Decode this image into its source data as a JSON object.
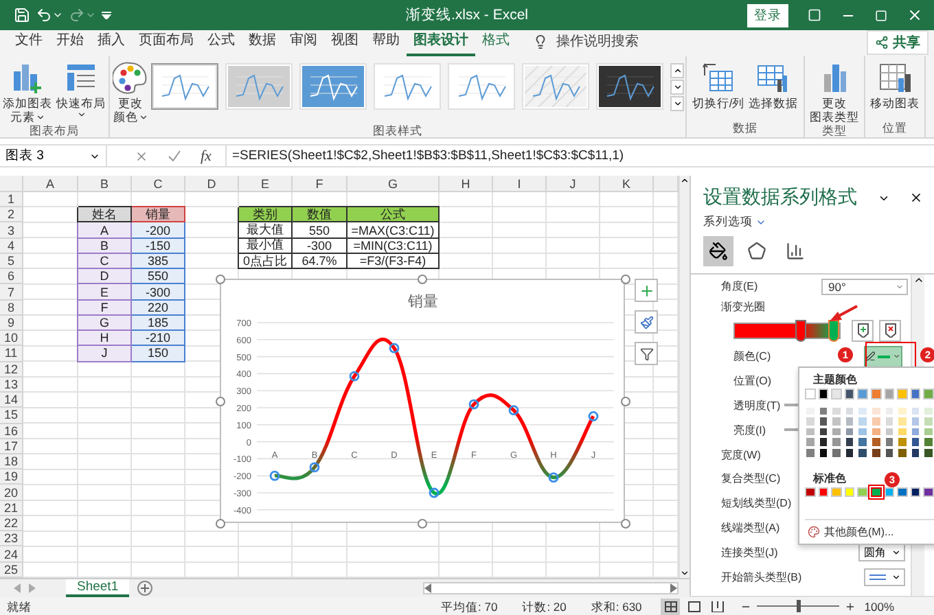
{
  "window": {
    "title": "渐变线.xlsx - Excel",
    "sign_in": "登录"
  },
  "quick_access": [
    {
      "kind": "save",
      "disabled": false
    },
    {
      "kind": "undo",
      "disabled": false
    },
    {
      "kind": "redo",
      "disabled": true
    },
    {
      "kind": "customize",
      "disabled": false
    }
  ],
  "tabs": [
    {
      "label": "文件",
      "selected": false,
      "contextual": false
    },
    {
      "label": "开始",
      "selected": false,
      "contextual": false
    },
    {
      "label": "插入",
      "selected": false,
      "contextual": false
    },
    {
      "label": "页面布局",
      "selected": false,
      "contextual": false
    },
    {
      "label": "公式",
      "selected": false,
      "contextual": false
    },
    {
      "label": "数据",
      "selected": false,
      "contextual": false
    },
    {
      "label": "审阅",
      "selected": false,
      "contextual": false
    },
    {
      "label": "视图",
      "selected": false,
      "contextual": false
    },
    {
      "label": "帮助",
      "selected": false,
      "contextual": false
    },
    {
      "label": "图表设计",
      "selected": true,
      "contextual": true
    },
    {
      "label": "格式",
      "selected": false,
      "contextual": true
    }
  ],
  "tell_me": "操作说明搜索",
  "share": "共享",
  "ribbon": {
    "groups": [
      {
        "label": "图表布局",
        "buttons": [
          {
            "kind": "add_element",
            "lines": [
              "添加图表",
              "元素"
            ],
            "menu": true
          },
          {
            "kind": "quick_layout",
            "lines": [
              "快速布局"
            ],
            "menu": true
          }
        ]
      },
      {
        "label": "图表样式",
        "buttons": [
          {
            "kind": "change_colors",
            "lines": [
              "更改",
              "颜色"
            ],
            "menu": true
          }
        ],
        "styles": [
          {
            "kind": "plain",
            "selected": true
          },
          {
            "kind": "gray",
            "selected": false
          },
          {
            "kind": "blue",
            "selected": false
          },
          {
            "kind": "plain",
            "selected": false
          },
          {
            "kind": "plain",
            "selected": false
          },
          {
            "kind": "hatched",
            "selected": false
          },
          {
            "kind": "dark",
            "selected": false
          }
        ]
      },
      {
        "label": "数据",
        "buttons": [
          {
            "kind": "switch",
            "lines": [
              "切换行/列"
            ],
            "menu": false
          },
          {
            "kind": "select_data",
            "lines": [
              "选择数据"
            ],
            "menu": false
          }
        ]
      },
      {
        "label": "类型",
        "buttons": [
          {
            "kind": "change_type",
            "lines": [
              "更改",
              "图表类型"
            ],
            "menu": false
          }
        ]
      },
      {
        "label": "位置",
        "buttons": [
          {
            "kind": "move",
            "lines": [
              "移动图表"
            ],
            "menu": false
          }
        ]
      }
    ]
  },
  "formula_bar": {
    "name_box": "图表 3",
    "function_label": "fx",
    "formula": "=SERIES(Sheet1!$C$2,Sheet1!$B$3:$B$11,Sheet1!$C$3:$C$11,1)"
  },
  "sheet": {
    "columns": [
      "A",
      "B",
      "C",
      "D",
      "E",
      "F",
      "G",
      "H",
      "I",
      "J",
      "K"
    ],
    "rows": [
      "1",
      "2",
      "3",
      "4",
      "5",
      "6",
      "7",
      "8",
      "9",
      "10",
      "11",
      "12",
      "13",
      "14",
      "15",
      "16",
      "17",
      "18",
      "19",
      "20",
      "21",
      "22",
      "23",
      "24",
      "25"
    ],
    "table_1": {
      "range_highlight": true,
      "header": [
        "姓名",
        "销量"
      ],
      "rows": [
        [
          "A",
          "-200"
        ],
        [
          "B",
          "-150"
        ],
        [
          "C",
          "385"
        ],
        [
          "D",
          "550"
        ],
        [
          "E",
          "-300"
        ],
        [
          "F",
          "220"
        ],
        [
          "G",
          "185"
        ],
        [
          "H",
          "-210"
        ],
        [
          "J",
          "150"
        ]
      ]
    },
    "table_2": {
      "header": [
        "类别",
        "数值",
        "公式"
      ],
      "rows": [
        [
          "最大值",
          "550",
          "=MAX(C3:C11)"
        ],
        [
          "最小值",
          "-300",
          "=MIN(C3:C11)"
        ],
        [
          "0点占比",
          "64.7%",
          "=F3/(F3-F4)"
        ]
      ]
    }
  },
  "chart": {
    "selected": true,
    "chart_data": {
      "type": "line",
      "title": "销量",
      "categories": [
        "A",
        "B",
        "C",
        "D",
        "E",
        "F",
        "G",
        "H",
        "J"
      ],
      "grid": true,
      "series": [
        {
          "marker": true,
          "values": [
            -200,
            -150,
            385,
            550,
            -300,
            220,
            185,
            -210,
            150
          ]
        }
      ],
      "ylim": [
        -400,
        700
      ],
      "yticks": [
        700,
        600,
        500,
        400,
        300,
        200,
        100,
        0,
        -100,
        -200,
        -300,
        -400
      ]
    }
  },
  "sheet_tabs": [
    {
      "label": "Sheet1",
      "selected": true
    }
  ],
  "format_pane": {
    "title": "设置数据系列格式",
    "section": "系列选项",
    "tabs": [
      {
        "kind": "fill",
        "selected": true
      },
      {
        "kind": "effects",
        "selected": false
      },
      {
        "kind": "series",
        "selected": false
      }
    ],
    "angle": {
      "label": "角度(E)",
      "value": "90°"
    },
    "gradient": {
      "label": "渐变光圈",
      "stops": [
        {
          "color": "#ff0000",
          "level": 0.63,
          "selected": false
        },
        {
          "color": "#00b050",
          "level": 0.95,
          "selected": true
        }
      ],
      "children": [
        {
          "label": "颜色(C)",
          "kind": "color",
          "color": "#00b050"
        },
        {
          "label": "位置(O)",
          "kind": "plain"
        },
        {
          "label": "透明度(T)",
          "kind": "slider"
        },
        {
          "label": "亮度(I)",
          "kind": "slider"
        }
      ]
    },
    "properties": [
      {
        "label": "宽度(W)",
        "kind": "plain"
      },
      {
        "label": "复合类型(C)",
        "kind": "plain"
      },
      {
        "label": "短划线类型(D)",
        "kind": "plain"
      },
      {
        "label": "线端类型(A)",
        "kind": "plain"
      },
      {
        "label": "连接类型(J)",
        "kind": "dropdown",
        "value": "圆角"
      },
      {
        "label": "开始箭头类型(B)",
        "kind": "arrow_dropdown"
      }
    ],
    "color_picker": {
      "theme_title": "主题颜色",
      "theme_colors": [
        {
          "color": "#ffffff",
          "selected": false
        },
        {
          "color": "#000000",
          "selected": false
        },
        {
          "color": "#e7e6e6",
          "selected": false
        },
        {
          "color": "#44546a",
          "selected": false
        },
        {
          "color": "#5b9bd5",
          "selected": false
        },
        {
          "color": "#ed7d31",
          "selected": false
        },
        {
          "color": "#a5a5a5",
          "selected": false
        },
        {
          "color": "#ffc000",
          "selected": false
        },
        {
          "color": "#4472c4",
          "selected": false
        },
        {
          "color": "#70ad47",
          "selected": false
        }
      ],
      "standard_title": "标准色",
      "standard_colors": [
        {
          "color": "#c00000",
          "selected": false
        },
        {
          "color": "#ff0000",
          "selected": false
        },
        {
          "color": "#ffc000",
          "selected": false
        },
        {
          "color": "#ffff00",
          "selected": false
        },
        {
          "color": "#92d050",
          "selected": false
        },
        {
          "color": "#00b050",
          "selected": true
        },
        {
          "color": "#00b0f0",
          "selected": false
        },
        {
          "color": "#0070c0",
          "selected": false
        },
        {
          "color": "#002060",
          "selected": false
        },
        {
          "color": "#7030a0",
          "selected": false
        }
      ],
      "more": "其他颜色(M)..."
    },
    "annotations": [
      "1",
      "2",
      "3"
    ]
  },
  "status_bar": {
    "status": "就绪",
    "stats": [
      "平均值: 70",
      "计数: 20",
      "求和: 630"
    ],
    "zoom": "100%",
    "zoom_slider": {
      "level": 0.5
    }
  }
}
